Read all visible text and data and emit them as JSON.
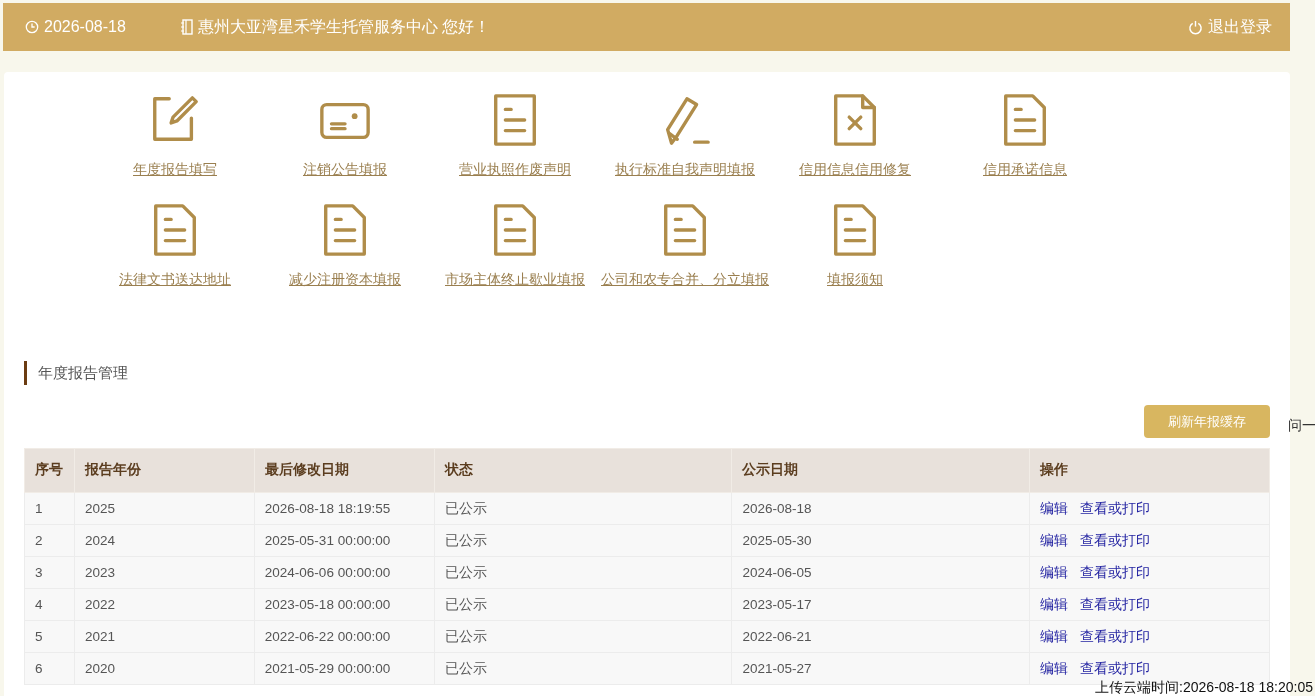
{
  "header": {
    "date": "2026-08-18",
    "greeting": "惠州大亚湾星禾学生托管服务中心 您好！",
    "logout": "退出登录"
  },
  "shortcuts": [
    {
      "kind": "edit",
      "label": "年度报告填写"
    },
    {
      "kind": "card",
      "label": "注销公告填报"
    },
    {
      "kind": "document",
      "label": "营业执照作废声明"
    },
    {
      "kind": "pencil",
      "label": "执行标准自我声明填报"
    },
    {
      "kind": "file-x",
      "label": "信用信息信用修复"
    },
    {
      "kind": "file",
      "label": "信用承诺信息"
    },
    {
      "kind": "file",
      "label": "法律文书送达地址"
    },
    {
      "kind": "file",
      "label": "减少注册资本填报"
    },
    {
      "kind": "file",
      "label": "市场主体终止歇业填报"
    },
    {
      "kind": "file",
      "label": "公司和农专合并、分立填报"
    },
    {
      "kind": "file",
      "label": "填报须知"
    }
  ],
  "section": {
    "title": "年度报告管理",
    "refresh_button": "刷新年报缓存"
  },
  "side_text": "问一",
  "table": {
    "columns": [
      "序号",
      "报告年份",
      "最后修改日期",
      "状态",
      "公示日期",
      "操作"
    ],
    "rows": [
      {
        "cells": [
          "1",
          "2025",
          "2026-08-18 18:19:55",
          "已公示",
          "2026-08-18"
        ],
        "actions": [
          "编辑",
          "查看或打印"
        ]
      },
      {
        "cells": [
          "2",
          "2024",
          "2025-05-31 00:00:00",
          "已公示",
          "2025-05-30"
        ],
        "actions": [
          "编辑",
          "查看或打印"
        ]
      },
      {
        "cells": [
          "3",
          "2023",
          "2024-06-06 00:00:00",
          "已公示",
          "2024-06-05"
        ],
        "actions": [
          "编辑",
          "查看或打印"
        ]
      },
      {
        "cells": [
          "4",
          "2022",
          "2023-05-18 00:00:00",
          "已公示",
          "2023-05-17"
        ],
        "actions": [
          "编辑",
          "查看或打印"
        ]
      },
      {
        "cells": [
          "5",
          "2021",
          "2022-06-22 00:00:00",
          "已公示",
          "2022-06-21"
        ],
        "actions": [
          "编辑",
          "查看或打印"
        ]
      },
      {
        "cells": [
          "6",
          "2020",
          "2021-05-29 00:00:00",
          "已公示",
          "2021-05-27"
        ],
        "actions": [
          "编辑",
          "查看或打印"
        ]
      }
    ]
  },
  "upload_time": "上传云端时间:2026-08-18 18:20:05"
}
